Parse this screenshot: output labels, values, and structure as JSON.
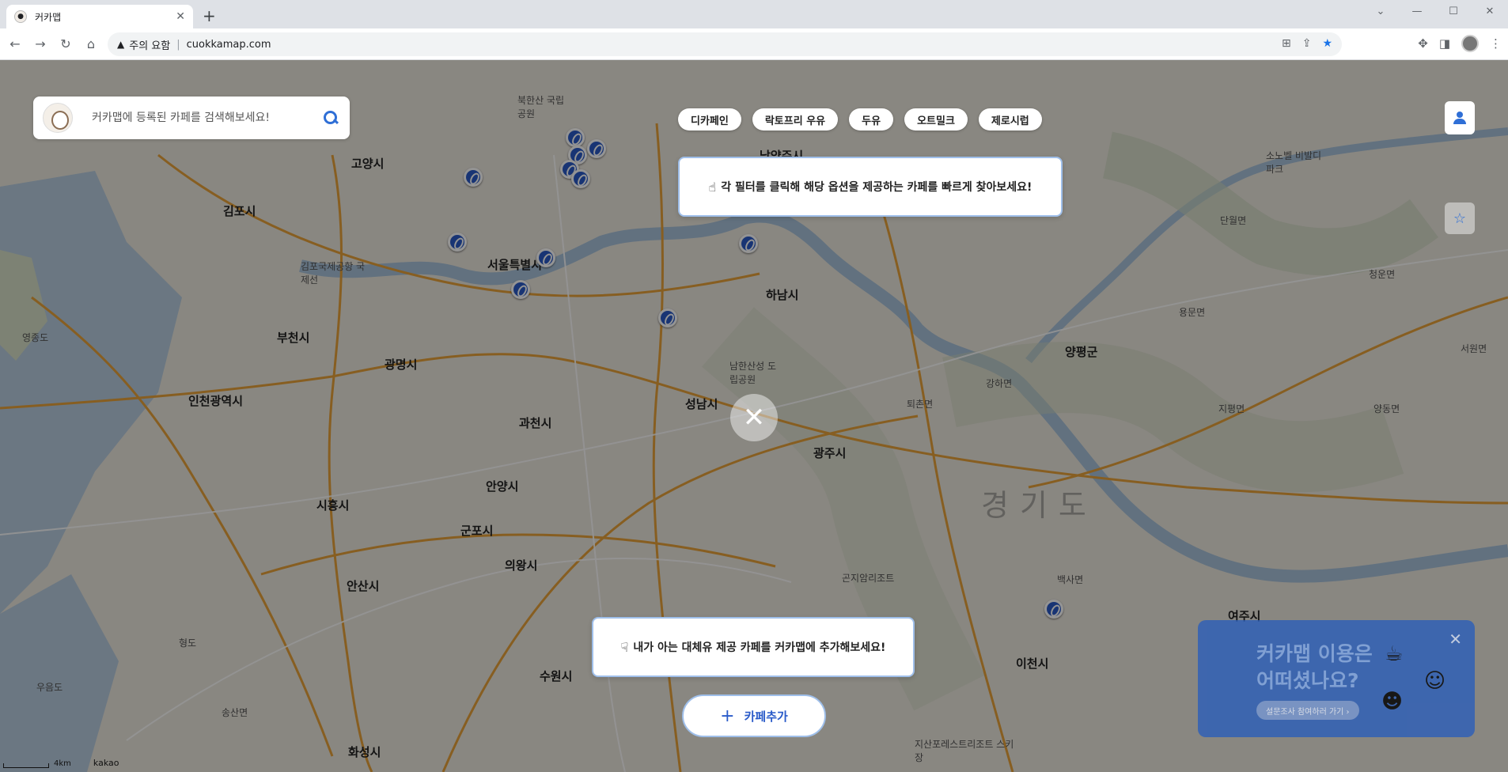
{
  "browser": {
    "tab_title": "커카맵",
    "security_label": "주의 요함",
    "url": "cuokkamap.com"
  },
  "search": {
    "placeholder": "커카맵에 등록된 카페를 검색해보세요!"
  },
  "filters": [
    "디카페인",
    "락토프리 우유",
    "두유",
    "오트밀크",
    "제로시럽"
  ],
  "tooltips": {
    "filter_hint": "각 필터를 클릭해 해당 옵션을 제공하는 카페를 빠르게 찾아보세요!",
    "add_hint": "내가 아는 대체유 제공 카페를 커카맵에 추가해보세요!"
  },
  "add_cafe_label": "카페추가",
  "survey": {
    "title": "커카맵 이용은\n어떠셨나요?",
    "button": "설문조사 참여하러 가기 ›"
  },
  "map": {
    "scale_label": "4km",
    "provider": "kakao",
    "region_label": "경기도",
    "places": [
      {
        "name": "서울특별시",
        "big": true
      },
      {
        "name": "인천광역시",
        "big": true
      },
      {
        "name": "부천시",
        "big": true
      },
      {
        "name": "광명시",
        "big": true
      },
      {
        "name": "김포시",
        "big": true
      },
      {
        "name": "고양시",
        "big": true
      },
      {
        "name": "하남시",
        "big": true
      },
      {
        "name": "성남시",
        "big": true
      },
      {
        "name": "과천시",
        "big": true
      },
      {
        "name": "안양시",
        "big": true
      },
      {
        "name": "군포시",
        "big": true
      },
      {
        "name": "의왕시",
        "big": true
      },
      {
        "name": "시흥시",
        "big": true
      },
      {
        "name": "안산시",
        "big": true
      },
      {
        "name": "수원시",
        "big": true
      },
      {
        "name": "화성시",
        "big": true
      },
      {
        "name": "광주시",
        "big": true
      },
      {
        "name": "양평군",
        "big": true
      },
      {
        "name": "이천시",
        "big": true
      },
      {
        "name": "남양주시",
        "big": true
      },
      {
        "name": "여주시",
        "big": true
      },
      {
        "name": "김포국제공항 국제선",
        "big": false
      },
      {
        "name": "남한산성 도립공원",
        "big": false
      },
      {
        "name": "북한산 국립공원",
        "big": false
      },
      {
        "name": "영종도",
        "big": false
      },
      {
        "name": "송산면",
        "big": false
      },
      {
        "name": "퇴촌면",
        "big": false
      },
      {
        "name": "강하면",
        "big": false
      },
      {
        "name": "지평면",
        "big": false
      },
      {
        "name": "양동면",
        "big": false
      },
      {
        "name": "소노벨 비발디파크",
        "big": false
      },
      {
        "name": "단월면",
        "big": false
      },
      {
        "name": "용문면",
        "big": false
      },
      {
        "name": "청운면",
        "big": false
      },
      {
        "name": "서원면",
        "big": false
      },
      {
        "name": "곤지암리조트",
        "big": false
      },
      {
        "name": "백사면",
        "big": false
      },
      {
        "name": "지산포레스트리조트 스키장",
        "big": false
      },
      {
        "name": "형도",
        "big": false
      },
      {
        "name": "우음도",
        "big": false
      }
    ]
  }
}
